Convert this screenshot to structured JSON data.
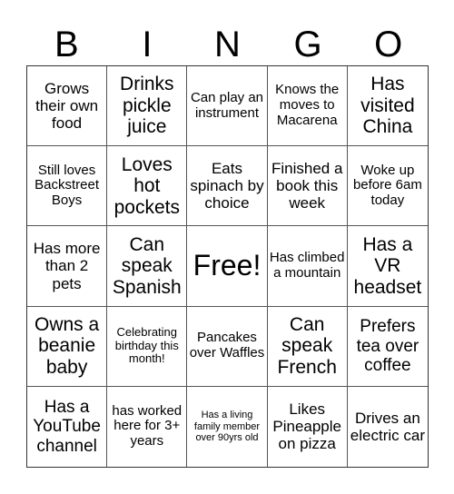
{
  "title_letters": [
    "B",
    "I",
    "N",
    "G",
    "O"
  ],
  "cells": [
    "Grows their own food",
    "Drinks pickle juice",
    "Can play an instrument",
    "Knows the moves to Macarena",
    "Has visited China",
    "Still loves Backstreet Boys",
    "Loves hot pockets",
    "Eats spinach by choice",
    "Finished a book this week",
    "Woke up before 6am today",
    "Has more than 2 pets",
    "Can speak Spanish",
    "Free!",
    "Has climbed a mountain",
    "Has a VR headset",
    "Owns a beanie baby",
    "Celebrating birthday this month!",
    "Pancakes over Waffles",
    "Can speak French",
    "Prefers tea over coffee",
    "Has a YouTube channel",
    "has worked here for 3+ years",
    "Has a living family member over 90yrs old",
    "Likes Pineapple on pizza",
    "Drives an electric car"
  ]
}
